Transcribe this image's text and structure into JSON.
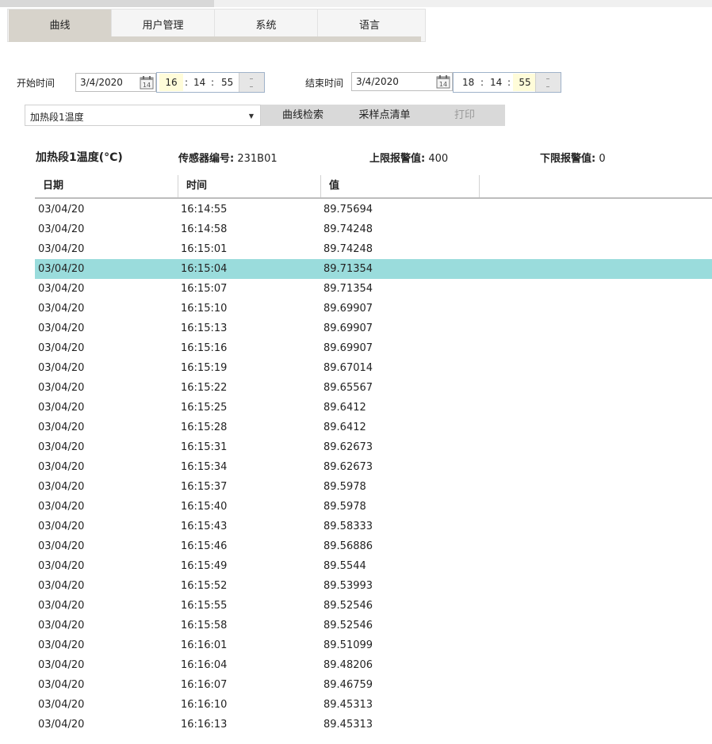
{
  "tabs": [
    {
      "label": "曲线",
      "active": true
    },
    {
      "label": "用户管理",
      "active": false
    },
    {
      "label": "系统",
      "active": false
    },
    {
      "label": "语言",
      "active": false
    }
  ],
  "filters": {
    "start_label": "开始时间",
    "start_date": "3/4/2020",
    "start_hour": "16",
    "start_minute": "14",
    "start_second": "55",
    "end_label": "结束时间",
    "end_date": "3/4/2020",
    "end_hour": "18",
    "end_minute": "14",
    "end_second": "55",
    "time_separator": ":",
    "calendar_day": "14",
    "channel": "加热段1温度"
  },
  "actions": {
    "search": "曲线检索",
    "samples": "采样点清单",
    "print": "打印"
  },
  "info": {
    "title": "加热段1温度(°C)",
    "sensor_label": "传感器编号:",
    "sensor_value": "231B01",
    "upper_label": "上限报警值:",
    "upper_value": "400",
    "lower_label": "下限报警值:",
    "lower_value": "0"
  },
  "table": {
    "headers": [
      "日期",
      "时间",
      "值"
    ],
    "selected_index": 3,
    "rows": [
      [
        "03/04/20",
        "16:14:55",
        "89.75694"
      ],
      [
        "03/04/20",
        "16:14:58",
        "89.74248"
      ],
      [
        "03/04/20",
        "16:15:01",
        "89.74248"
      ],
      [
        "03/04/20",
        "16:15:04",
        "89.71354"
      ],
      [
        "03/04/20",
        "16:15:07",
        "89.71354"
      ],
      [
        "03/04/20",
        "16:15:10",
        "89.69907"
      ],
      [
        "03/04/20",
        "16:15:13",
        "89.69907"
      ],
      [
        "03/04/20",
        "16:15:16",
        "89.69907"
      ],
      [
        "03/04/20",
        "16:15:19",
        "89.67014"
      ],
      [
        "03/04/20",
        "16:15:22",
        "89.65567"
      ],
      [
        "03/04/20",
        "16:15:25",
        "89.6412"
      ],
      [
        "03/04/20",
        "16:15:28",
        "89.6412"
      ],
      [
        "03/04/20",
        "16:15:31",
        "89.62673"
      ],
      [
        "03/04/20",
        "16:15:34",
        "89.62673"
      ],
      [
        "03/04/20",
        "16:15:37",
        "89.5978"
      ],
      [
        "03/04/20",
        "16:15:40",
        "89.5978"
      ],
      [
        "03/04/20",
        "16:15:43",
        "89.58333"
      ],
      [
        "03/04/20",
        "16:15:46",
        "89.56886"
      ],
      [
        "03/04/20",
        "16:15:49",
        "89.5544"
      ],
      [
        "03/04/20",
        "16:15:52",
        "89.53993"
      ],
      [
        "03/04/20",
        "16:15:55",
        "89.52546"
      ],
      [
        "03/04/20",
        "16:15:58",
        "89.52546"
      ],
      [
        "03/04/20",
        "16:16:01",
        "89.51099"
      ],
      [
        "03/04/20",
        "16:16:04",
        "89.48206"
      ],
      [
        "03/04/20",
        "16:16:07",
        "89.46759"
      ],
      [
        "03/04/20",
        "16:16:10",
        "89.45313"
      ],
      [
        "03/04/20",
        "16:16:13",
        "89.45313"
      ]
    ]
  },
  "colors": {
    "active_tab": "#d7d3cb",
    "selected_row": "#9adcdc",
    "time_highlight": "#fffcd9",
    "button_bar": "#d9d9d9"
  }
}
